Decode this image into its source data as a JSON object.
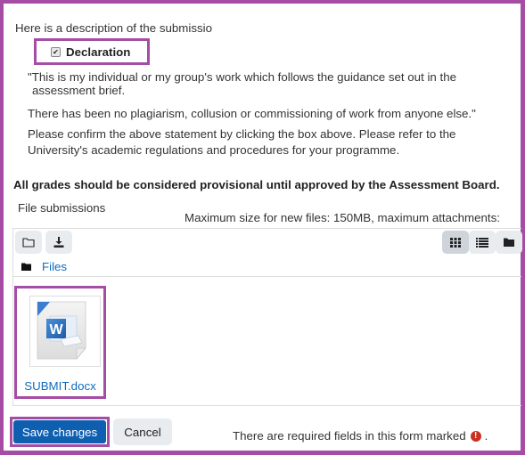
{
  "submission": {
    "description_label": "Here is a description of the submissio",
    "declaration": {
      "label": "Declaration",
      "checked": true
    },
    "statement_line1": "\"This is my individual or my group's work which follows the guidance set out in the",
    "statement_line2": "assessment brief.",
    "statement_line3": "There has been no plagiarism, collusion or commissioning of work from anyone else.\"",
    "confirm_line1": "Please confirm the above statement by clicking the box above. Please refer to the",
    "confirm_line2": "University's academic  regulations and procedures for your programme.",
    "grades_notice": "All grades should be considered provisional until approved by the Assessment Board."
  },
  "file_manager": {
    "label": "File submissions",
    "limits": "Maximum size for new files: 150MB, maximum attachments:",
    "toolbar": {
      "create_folder_icon": "folder-outline-icon",
      "download_icon": "download-icon",
      "view_icons_icon": "grid-icon",
      "view_list_icon": "list-icon",
      "view_tree_icon": "folder-icon",
      "active_view": "icons"
    },
    "path_label": "Files",
    "files": [
      {
        "name": "SUBMIT.docx",
        "type": "word-document"
      }
    ]
  },
  "actions": {
    "save_label": "Save changes",
    "cancel_label": "Cancel",
    "required_text": "There are required fields in this form marked",
    "required_suffix": ".",
    "required_icon": "!"
  },
  "colors": {
    "highlight": "#a54ca5",
    "primary": "#0f5fb0",
    "link": "#0f6cbf",
    "required": "#ca3120"
  }
}
